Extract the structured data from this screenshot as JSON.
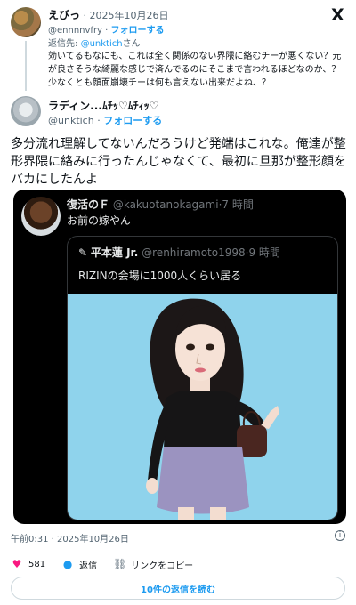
{
  "reply": {
    "display_name": "えびっ",
    "separator": "·",
    "date": "2025年10月26日",
    "handle": "@ennnnvfry",
    "follow_sep": "·",
    "follow_label": "フォローする",
    "reply_to_label": "返信先:",
    "reply_to_handle": "@unktich",
    "reply_to_suffix": "さん",
    "text": "効いてるもなにも、これは全く関係のない界隈に絡むチーが悪くない？元が良さそうな綺麗な感じで済んでるのにそこまで言われるほどなのか、？少なくとも顔面崩壊チーは何も言えない出来だよね、？"
  },
  "main": {
    "display_name": "ラディン...ﾑﾁｯ♡ﾑﾁｨｯ♡",
    "handle": "@unktich",
    "follow_sep": "·",
    "follow_label": "フォローする",
    "text": "多分流れ理解してないんだろうけど発端はこれな。俺達が整形界隈に絡みに行ったんじゃなくて、最初に旦那が整形顔をバカにしたんよ",
    "timestamp": "午前0:31 · 2025年10月26日",
    "info_icon": "i"
  },
  "quote": {
    "display_name": "復活のＦ",
    "handle": "@kakuotanokagami",
    "time": "·7 時間",
    "text": "お前の嫁やん",
    "inner": {
      "display_name": "平本蓮 Jr.",
      "handle": "@renhiramoto1998",
      "time": "·9 時間",
      "text": "RIZINの会場に1000人くらい居る"
    }
  },
  "actions": {
    "like_icon": "heart-icon",
    "like_count": "581",
    "reply_icon": "reply-bubble-icon",
    "reply_label": "返信",
    "copy_icon": "link-icon",
    "copy_label": "リンクをコピー",
    "read_replies_label": "10件の返信を読む"
  },
  "colors": {
    "accent": "#1d9bf0",
    "like": "#f91880",
    "text": "#0f1419",
    "muted": "#536471"
  }
}
